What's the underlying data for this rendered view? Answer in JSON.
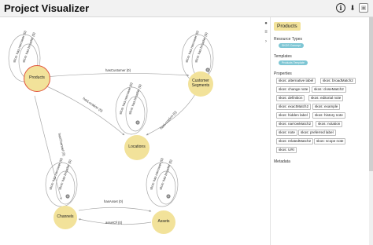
{
  "header": {
    "title": "Project Visualizer",
    "buttons": {
      "info_glyph": "i",
      "download_glyph": "⬇",
      "export_glyph": "▣"
    }
  },
  "graph": {
    "nodes": [
      {
        "id": "products",
        "label": "Products",
        "selected": true
      },
      {
        "id": "customer_segments",
        "label": "Customer Segments"
      },
      {
        "id": "locations",
        "label": "Locations"
      },
      {
        "id": "channels",
        "label": "Channels"
      },
      {
        "id": "assets",
        "label": "Assets"
      }
    ],
    "edges": [
      {
        "label": "hasCustomer (0)"
      },
      {
        "label": "hasLocation (0)"
      },
      {
        "label": "hasLocation (0)"
      },
      {
        "label": "hasChannel (0)"
      },
      {
        "label": "hasAsset (0)"
      },
      {
        "label": "assetOf (0)"
      }
    ],
    "loop_labels": {
      "narrower": "skos: has narrower (0)",
      "broader": "skos: has broader (0)"
    },
    "badge": "0"
  },
  "side_tools": {
    "info_glyph": "●",
    "filter_glyph": "≡",
    "expand_glyph": "›"
  },
  "panel": {
    "title": "Products",
    "resource_types_heading": "Resource Types",
    "resource_type": "SKOS Concept",
    "templates_heading": "Templates",
    "template": "Products Template",
    "properties_heading": "Properties",
    "properties": [
      "skos: alternative label",
      "skos: broadMatch2",
      "skos: change note",
      "skos: closeMatch2",
      "skos: definition",
      "skos: editorial note",
      "skos: exactMatch2",
      "skos: example",
      "skos: hidden label",
      "skos: history note",
      "skos: narrowMatch2",
      "skos: notation",
      "skos: note",
      "skos: preferred label",
      "skos: relatedMatch2",
      "skos: scope note",
      "skos: URI"
    ],
    "metadata_heading": "Metadata"
  }
}
